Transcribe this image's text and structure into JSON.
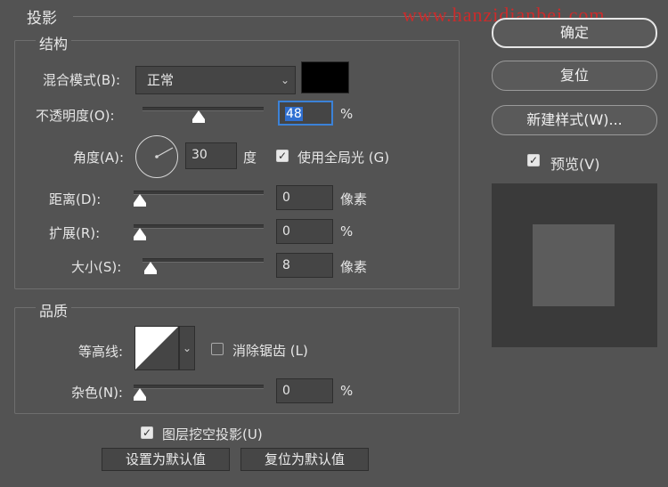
{
  "dialog": {
    "section_title": "投影",
    "watermark": "www.hanzidianbei.com"
  },
  "structure": {
    "title": "结构",
    "blend_mode_label": "混合模式(B):",
    "blend_mode_value": "正常",
    "shadow_color": "#000000",
    "opacity_label": "不透明度(O):",
    "opacity_value": "48",
    "opacity_unit": "%",
    "angle_label": "角度(A):",
    "angle_value": "30",
    "angle_unit": "度",
    "global_light_label": "使用全局光 (G)",
    "global_light_checked": true,
    "distance_label": "距离(D):",
    "distance_value": "0",
    "distance_unit": "像素",
    "spread_label": "扩展(R):",
    "spread_value": "0",
    "spread_unit": "%",
    "size_label": "大小(S):",
    "size_value": "8",
    "size_unit": "像素"
  },
  "quality": {
    "title": "品质",
    "contour_label": "等高线:",
    "anti_alias_label": "消除锯齿 (L)",
    "anti_alias_checked": false,
    "noise_label": "杂色(N):",
    "noise_value": "0",
    "noise_unit": "%"
  },
  "footer": {
    "knockout_label": "图层挖空投影(U)",
    "knockout_checked": true,
    "make_default_label": "设置为默认值",
    "reset_default_label": "复位为默认值"
  },
  "side": {
    "ok_label": "确定",
    "reset_label": "复位",
    "new_style_label": "新建样式(W)...",
    "preview_label": "预览(V)",
    "preview_checked": true
  },
  "icons": {
    "check": "check-icon",
    "dropdown": "chevron-down-icon",
    "slider": "slider-thumb-icon"
  }
}
